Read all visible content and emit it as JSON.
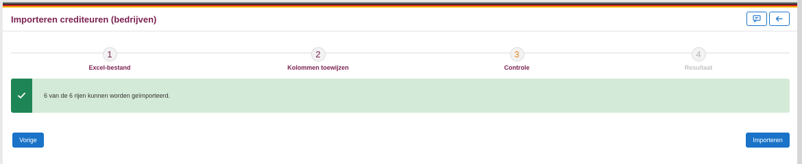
{
  "header": {
    "title": "Importeren crediteuren (bedrijven)"
  },
  "steps": [
    {
      "number": "1",
      "label": "Excel-bestand",
      "number_color": "#7b2250",
      "label_color": "#7b2250"
    },
    {
      "number": "2",
      "label": "Kolommen toewijzen",
      "number_color": "#7b2250",
      "label_color": "#7b2250"
    },
    {
      "number": "3",
      "label": "Controle",
      "number_color": "#e08a2b",
      "label_color": "#7b2250"
    },
    {
      "number": "4",
      "label": "Resultaat",
      "number_color": "#b5b5b5",
      "label_color": "#c4c4c4"
    }
  ],
  "alert": {
    "text": "6 van de 6 rijen kunnen worden geïmporteerd.",
    "icon": "check-icon"
  },
  "footer": {
    "prev_label": "Vorige",
    "import_label": "Importeren"
  },
  "colors": {
    "accent": "#1a73c8",
    "brand": "#7b2250",
    "success": "#1e8656",
    "success_bg": "#d4ead8"
  }
}
